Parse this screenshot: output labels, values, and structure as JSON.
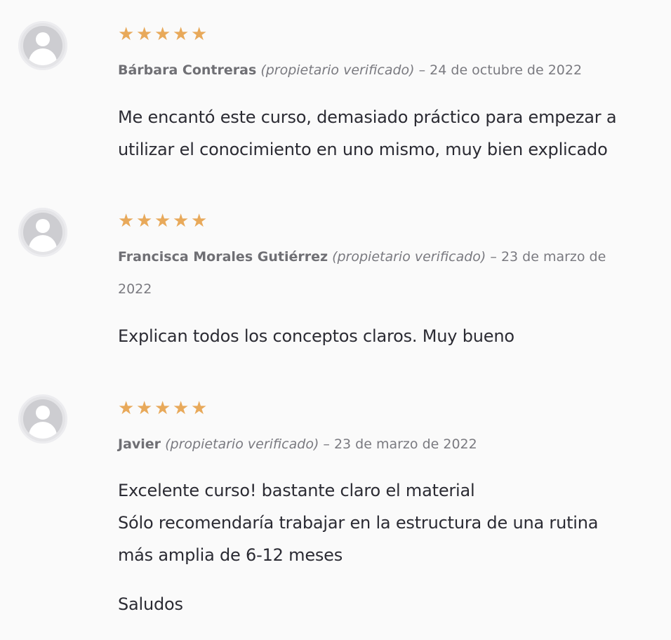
{
  "reviews": [
    {
      "rating": 5,
      "author": "Bárbara Contreras",
      "verified": "(propietario verificado)",
      "date": "– 24 de octubre de 2022",
      "paragraphs": [
        "Me encantó este curso, demasiado práctico para empezar a utilizar el conocimiento en uno mismo, muy bien explicado"
      ]
    },
    {
      "rating": 5,
      "author": "Francisca Morales Gutiérrez",
      "verified": "(propietario verificado)",
      "date": "– 23 de marzo de 2022",
      "paragraphs": [
        "Explican todos los conceptos claros. Muy bueno"
      ]
    },
    {
      "rating": 5,
      "author": "Javier",
      "verified": "(propietario verificado)",
      "date": "– 23 de marzo de 2022",
      "paragraphs": [
        "Excelente curso! bastante claro el material",
        "Sólo recomendaría trabajar en la estructura de una rutina más amplia de 6-12 meses",
        "Saludos"
      ]
    }
  ],
  "icons": {
    "star": "star-icon",
    "avatar": "user-avatar-icon"
  },
  "colors": {
    "star": "#e8a95a",
    "background": "#fafafa",
    "meta_text": "#7a7a80",
    "body_text": "#2b2b33"
  }
}
